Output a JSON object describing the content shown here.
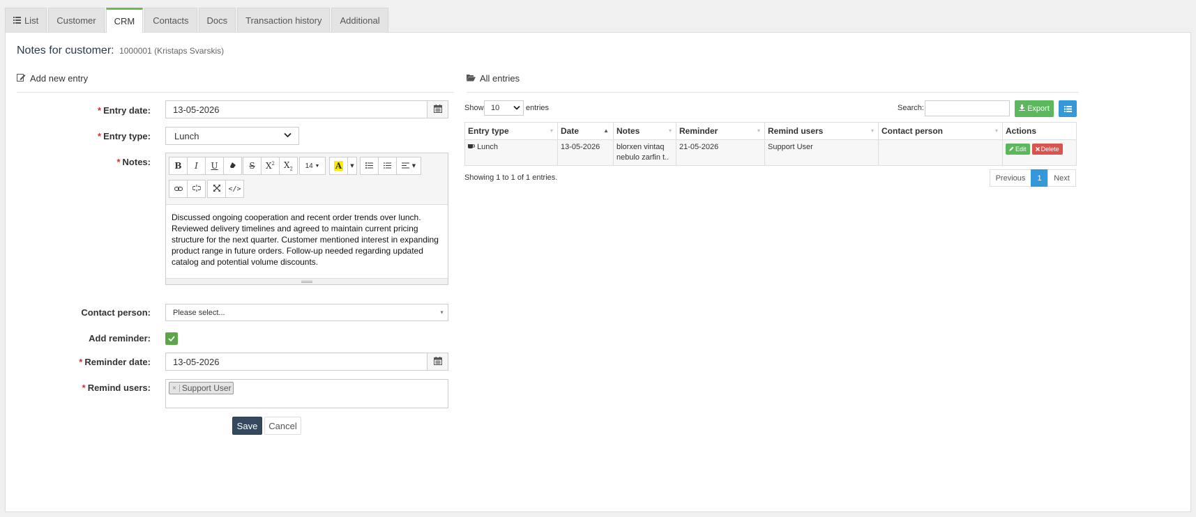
{
  "tabs": [
    {
      "label": "List",
      "icon": "list-icon"
    },
    {
      "label": "Customer"
    },
    {
      "label": "CRM",
      "active": true
    },
    {
      "label": "Contacts"
    },
    {
      "label": "Docs"
    },
    {
      "label": "Transaction history"
    },
    {
      "label": "Additional"
    }
  ],
  "page": {
    "title": "Notes for customer:",
    "subtitle": "1000001 (Kristaps Svarskis)"
  },
  "form": {
    "heading": "Add new entry",
    "entry_date_label": "Entry date:",
    "entry_date_value": "13-05-2026",
    "entry_type_label": "Entry type:",
    "entry_type_value": "Lunch",
    "notes_label": "Notes:",
    "font_size": "14",
    "notes_text": "Discussed ongoing cooperation and recent order trends over lunch. Reviewed delivery timelines and agreed to maintain current pricing structure for the next quarter. Customer mentioned interest in expanding product range in future orders. Follow-up needed regarding updated catalog and potential volume discounts.",
    "contact_label": "Contact person:",
    "contact_placeholder": "Please select...",
    "reminder_label": "Add reminder:",
    "reminder_checked": true,
    "reminder_date_label": "Reminder date:",
    "reminder_date_value": "13-05-2026",
    "remind_users_label": "Remind users:",
    "remind_users_tag": "Support User",
    "save_label": "Save",
    "cancel_label": "Cancel",
    "required_mark": "*"
  },
  "entries": {
    "heading": "All entries",
    "show_label": "Show",
    "page_size": "10",
    "entries_label": "entries",
    "search_label": "Search:",
    "export_label": "Export",
    "columns": [
      "Entry type",
      "Date",
      "Notes",
      "Reminder",
      "Remind users",
      "Contact person",
      "Actions"
    ],
    "rows": [
      {
        "entry_type": "Lunch",
        "date": "13-05-2026",
        "notes": "blorxen vintaq nebulo zarfin t..",
        "reminder": "21-05-2026",
        "remind_users": "Support User",
        "contact_person": "",
        "edit_label": "Edit",
        "delete_label": "Delete"
      }
    ],
    "info": "Showing 1 to 1 of 1 entries.",
    "pager": {
      "previous": "Previous",
      "current": "1",
      "next": "Next"
    }
  },
  "colors": {
    "accent_green": "#6abd45",
    "save_button": "#34495e",
    "export_button": "#5cb85c",
    "primary_blue": "#3498db",
    "delete_red": "#d9534f"
  }
}
